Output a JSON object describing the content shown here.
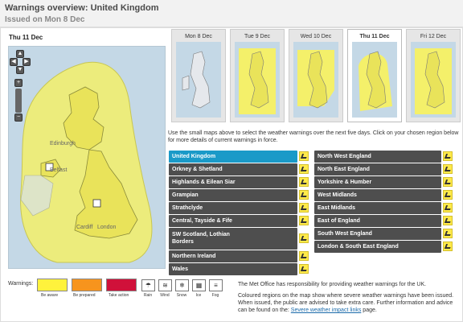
{
  "header": {
    "title": "Warnings overview: United Kingdom",
    "subtitle": "Issued on Mon 8 Dec"
  },
  "map": {
    "day_label": "Thu 11 Dec",
    "cities": [
      "Edinburgh",
      "Belfast",
      "Cardiff",
      "London"
    ]
  },
  "days": [
    {
      "label": "Mon 8 Dec",
      "active": false
    },
    {
      "label": "Tue 9 Dec",
      "active": false
    },
    {
      "label": "Wed 10 Dec",
      "active": false
    },
    {
      "label": "Thu 11 Dec",
      "active": true
    },
    {
      "label": "Fri 12 Dec",
      "active": false
    }
  ],
  "instructions": "Use the small maps above to select the weather warnings over the next five days. Click on your chosen region below for more details of current warnings in force.",
  "regions_left": [
    {
      "label": "United Kingdom",
      "selected": true
    },
    {
      "label": "Orkney & Shetland"
    },
    {
      "label": "Highlands & Eilean Siar"
    },
    {
      "label": "Grampian"
    },
    {
      "label": "Strathclyde"
    },
    {
      "label": "Central, Tayside & Fife"
    },
    {
      "label_line1": "SW Scotland, Lothian",
      "label_line2": "Borders"
    },
    {
      "label": "Northern Ireland"
    },
    {
      "label": "Wales"
    }
  ],
  "regions_right": [
    {
      "label": "North West England"
    },
    {
      "label": "North East England"
    },
    {
      "label": "Yorkshire & Humber"
    },
    {
      "label": "West Midlands"
    },
    {
      "label": "East Midlands"
    },
    {
      "label": "East of England"
    },
    {
      "label": "South West England"
    },
    {
      "label": "London & South East England"
    }
  ],
  "legend": {
    "label": "Warnings:",
    "levels": [
      {
        "caption": "Be aware",
        "color": "#fff23c"
      },
      {
        "caption": "Be prepared",
        "color": "#f7941d"
      },
      {
        "caption": "Take action",
        "color": "#d0113a"
      }
    ],
    "types": [
      {
        "caption": "Rain",
        "icon": "rain-icon",
        "glyph": "☂"
      },
      {
        "caption": "Wind",
        "icon": "wind-icon",
        "glyph": "≋"
      },
      {
        "caption": "Snow",
        "icon": "snow-icon",
        "glyph": "❄"
      },
      {
        "caption": "Ice",
        "icon": "ice-icon",
        "glyph": "▦"
      },
      {
        "caption": "Fog",
        "icon": "fog-icon",
        "glyph": "≡"
      }
    ]
  },
  "footer": {
    "responsibility": "The Met Office has responsibility for providing weather warnings for the UK.",
    "explanation": "Coloured regions on the map show where severe weather warnings have been issued. When issued, the public are advised to take extra care. Further information and advice can be found on the:",
    "link_text": "Severe weather impact links",
    "link_suffix": "page."
  },
  "colors": {
    "warning_yellow": "#fff23c",
    "selected_region": "#1a9ac8",
    "region_bg": "#4e4e4e",
    "sea": "#c4d8e6"
  }
}
